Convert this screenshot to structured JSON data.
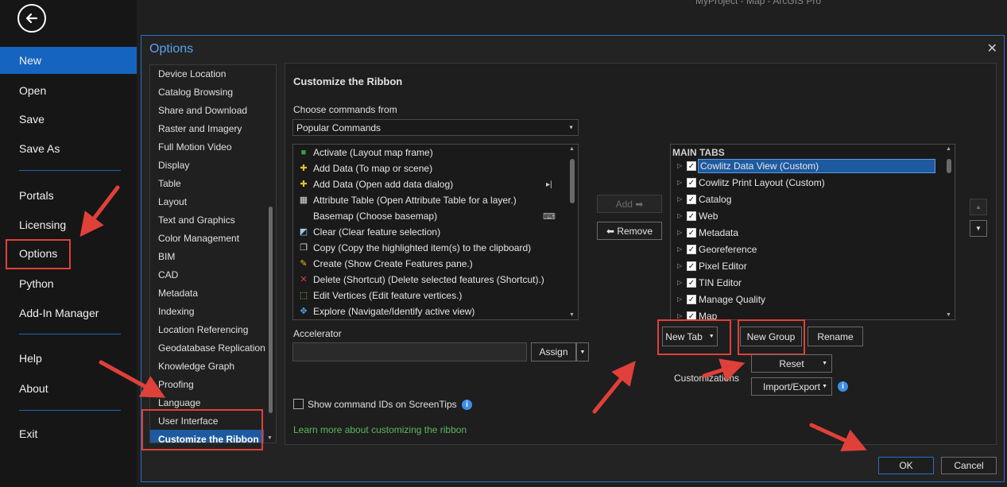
{
  "app": {
    "title": "MyProject - Map - ArcGIS Pro"
  },
  "backstage": {
    "items": [
      {
        "label": "New",
        "active": true
      },
      {
        "label": "Open"
      },
      {
        "label": "Save"
      },
      {
        "label": "Save As"
      },
      {
        "label": "Portals"
      },
      {
        "label": "Licensing"
      },
      {
        "label": "Options"
      },
      {
        "label": "Python"
      },
      {
        "label": "Add-In Manager"
      },
      {
        "label": "Help"
      },
      {
        "label": "About"
      },
      {
        "label": "Exit"
      }
    ]
  },
  "dialog": {
    "title": "Options",
    "close_glyph": "✕",
    "categories": [
      "Device Location",
      "Catalog Browsing",
      "Share and Download",
      "Raster and Imagery",
      "Full Motion Video",
      "Display",
      "Table",
      "Layout",
      "Text and Graphics",
      "Color Management",
      "BIM",
      "CAD",
      "Metadata",
      "Indexing",
      "Location Referencing",
      "Geodatabase Replication",
      "Knowledge Graph",
      "Proofing",
      "Language",
      "User Interface",
      "Customize the Ribbon"
    ],
    "selected_category": "Customize the Ribbon",
    "ok_label": "OK",
    "cancel_label": "Cancel"
  },
  "panel": {
    "heading": "Customize the Ribbon",
    "choose_label": "Choose commands from",
    "choose_value": "Popular Commands",
    "commands": [
      {
        "label": "Activate (Layout map frame)",
        "icon": "map-frame-icon"
      },
      {
        "label": "Add Data (To map or scene)",
        "icon": "add-data-icon"
      },
      {
        "label": "Add Data (Open add data dialog)",
        "icon": "add-data-icon",
        "submenu": true
      },
      {
        "label": "Attribute Table (Open Attribute Table for a layer.)",
        "icon": "table-icon"
      },
      {
        "label": "Basemap (Choose basemap)",
        "icon": "",
        "trailing": "keyboard-icon"
      },
      {
        "label": "Clear (Clear feature selection)",
        "icon": "clear-selection-icon"
      },
      {
        "label": "Copy (Copy the highlighted item(s) to the clipboard)",
        "icon": "copy-icon"
      },
      {
        "label": "Create (Show Create Features pane.)",
        "icon": "create-features-icon"
      },
      {
        "label": "Delete (Shortcut) (Delete selected features (Shortcut).)",
        "icon": "delete-icon"
      },
      {
        "label": "Edit Vertices (Edit feature vertices.)",
        "icon": "edit-vertices-icon"
      },
      {
        "label": "Explore (Navigate/Identify active view)",
        "icon": "explore-icon"
      }
    ],
    "add_label": "Add ➡",
    "remove_label": "⬅ Remove",
    "accelerator_label": "Accelerator",
    "accelerator_value": "",
    "assign_label": "Assign",
    "show_ids_label": "Show command IDs on ScreenTips",
    "learn_link": "Learn more about customizing the ribbon",
    "tabs_header": "MAIN TABS",
    "tabs": [
      {
        "label": "Cowlitz Data View (Custom)",
        "checked": true,
        "selected": true
      },
      {
        "label": "Cowlitz Print Layout (Custom)",
        "checked": true
      },
      {
        "label": "Catalog",
        "checked": true
      },
      {
        "label": "Web",
        "checked": true
      },
      {
        "label": "Metadata",
        "checked": true
      },
      {
        "label": "Georeference",
        "checked": true
      },
      {
        "label": "Pixel Editor",
        "checked": true
      },
      {
        "label": "TIN Editor",
        "checked": true
      },
      {
        "label": "Manage Quality",
        "checked": true
      },
      {
        "label": "Map",
        "checked": true
      }
    ],
    "new_tab_label": "New Tab",
    "new_group_label": "New Group",
    "rename_label": "Rename",
    "customizations_label": "Customizations",
    "reset_label": "Reset",
    "import_export_label": "Import/Export",
    "up_glyph": "▲",
    "down_glyph": "▼"
  },
  "colors": {
    "accent": "#1565c0",
    "callout": "#e0403a",
    "link": "#5cb85c"
  }
}
